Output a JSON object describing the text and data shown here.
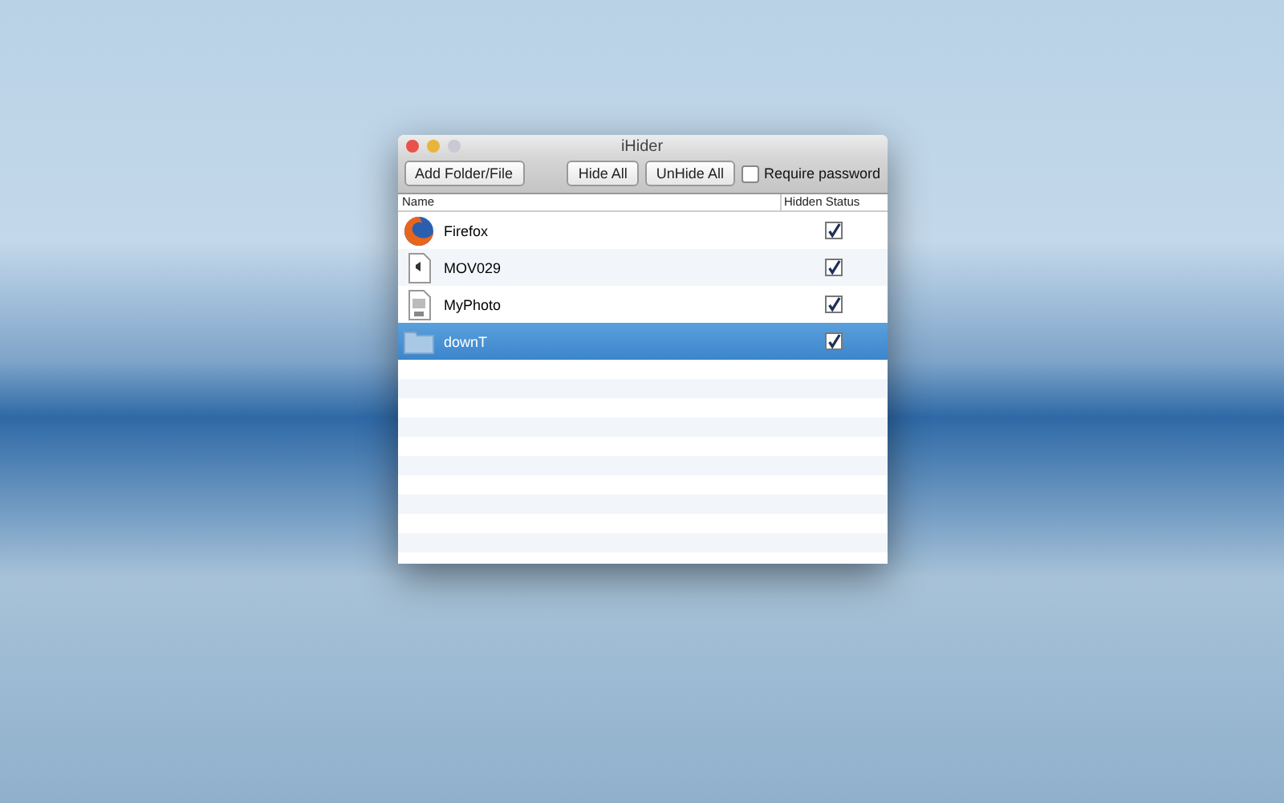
{
  "window": {
    "title": "iHider"
  },
  "toolbar": {
    "buttons": [
      "Add Folder/File",
      "Hide All",
      "UnHide All"
    ],
    "require_password": {
      "label": "Require password",
      "checked": false
    }
  },
  "table": {
    "columns": [
      "Name",
      "Hidden Status"
    ],
    "rows": [
      {
        "kind": "app",
        "name": "Firefox",
        "hidden": true,
        "selected": false
      },
      {
        "kind": "movie",
        "name": "MOV029",
        "hidden": true,
        "selected": false
      },
      {
        "kind": "image",
        "name": "MyPhoto",
        "hidden": true,
        "selected": false
      },
      {
        "kind": "folder",
        "name": "downT",
        "hidden": true,
        "selected": true
      }
    ]
  }
}
